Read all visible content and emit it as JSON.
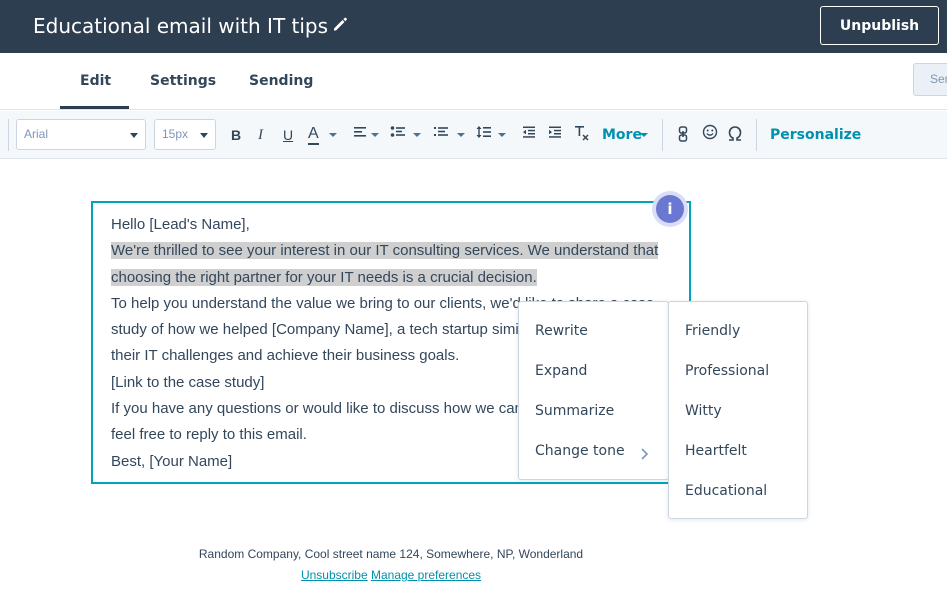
{
  "header": {
    "title": "Educational email with IT tips",
    "unpublish_label": "Unpublish"
  },
  "tabs": [
    {
      "label": "Edit",
      "active": true
    },
    {
      "label": "Settings",
      "active": false
    },
    {
      "label": "Sending",
      "active": false
    }
  ],
  "send_button_label": "Sen",
  "toolbar": {
    "font_family": "Arial",
    "font_size": "15px",
    "bold": "B",
    "italic": "I",
    "underline": "U",
    "text_color": "A",
    "more_label": "More",
    "personalize_label": "Personalize"
  },
  "email_body": {
    "lines": [
      "Hello [Lead's Name],",
      "We're thrilled to see your interest in our IT consulting services. We understand that",
      "choosing the right partner for your IT needs is a crucial decision.",
      "To help you understand the value we bring to our clients, we'd like to share a case",
      "study of how we helped [Company Name], a tech startup similar to yours, overcome",
      "their IT challenges and achieve their business goals.",
      "[Link to the case study]",
      "If you have any questions or would like to discuss how we can help your business,",
      "feel free to reply to this email.",
      "Best, [Your Name]"
    ],
    "highlighted_lines": [
      1,
      2
    ]
  },
  "info_badge_label": "i",
  "ai_menu": {
    "items": [
      "Rewrite",
      "Expand",
      "Summarize",
      "Change tone"
    ]
  },
  "tone_menu": {
    "items": [
      "Friendly",
      "Professional",
      "Witty",
      "Heartfelt",
      "Educational"
    ]
  },
  "footer": {
    "address": "Random Company, Cool street name 124, Somewhere, NP, Wonderland",
    "unsubscribe_label": "Unsubscribe",
    "manage_preferences_label": "Manage preferences"
  },
  "colors": {
    "header_bg": "#2d3e50",
    "accent": "#0091ae",
    "selection_border": "#00a4bd",
    "info_badge": "#6a78d1"
  }
}
